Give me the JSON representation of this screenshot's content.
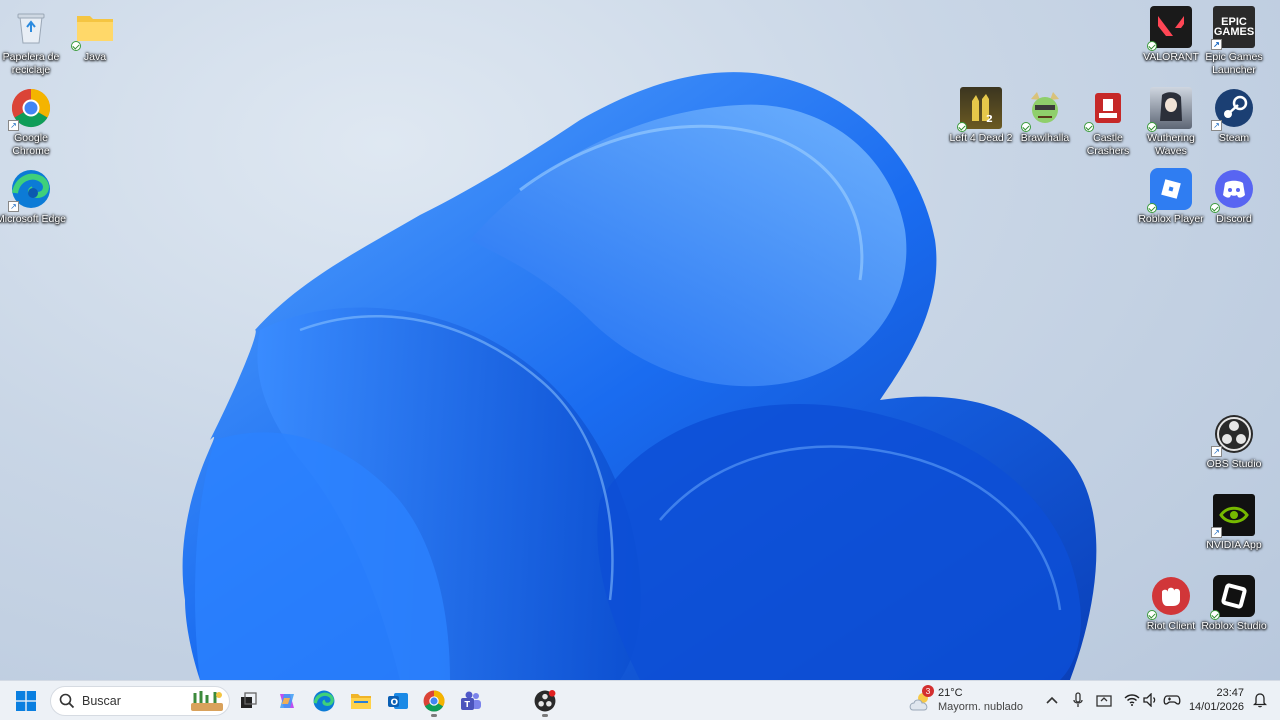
{
  "desktop": {
    "icons": [
      {
        "label": "Papelera de reciclaje",
        "icon": "recycle-bin-icon"
      },
      {
        "label": "Java",
        "icon": "folder-icon"
      },
      {
        "label": "Google Chrome",
        "icon": "chrome-icon"
      },
      {
        "label": "Microsoft Edge",
        "icon": "edge-icon"
      },
      {
        "label": "VALORANT",
        "icon": "valorant-icon"
      },
      {
        "label": "Epic Games Launcher",
        "icon": "epic-games-icon",
        "glyph_text": "EPIC\nGAMES"
      },
      {
        "label": "Left 4 Dead 2",
        "icon": "left4dead2-icon"
      },
      {
        "label": "Brawlhalla",
        "icon": "brawlhalla-icon"
      },
      {
        "label": "Castle Crashers",
        "icon": "castle-crashers-icon"
      },
      {
        "label": "Wuthering Waves",
        "icon": "wuthering-waves-icon"
      },
      {
        "label": "Steam",
        "icon": "steam-icon"
      },
      {
        "label": "Roblox Player",
        "icon": "roblox-player-icon"
      },
      {
        "label": "Discord",
        "icon": "discord-icon"
      },
      {
        "label": "OBS Studio",
        "icon": "obs-icon"
      },
      {
        "label": "NVIDIA App",
        "icon": "nvidia-icon"
      },
      {
        "label": "Riot Client",
        "icon": "riot-client-icon"
      },
      {
        "label": "Roblox Studio",
        "icon": "roblox-studio-icon"
      }
    ]
  },
  "taskbar": {
    "search_placeholder": "Buscar",
    "apps": [
      "start-icon",
      "task-view-icon",
      "copilot-icon",
      "edge-icon",
      "file-explorer-icon",
      "outlook-icon",
      "chrome-icon",
      "teams-icon",
      "obs-icon"
    ],
    "weather": {
      "badge": "3",
      "temp": "21°C",
      "desc": "Mayorm. nublado"
    },
    "clock": {
      "time": "23:47",
      "date": "14/01/2026"
    }
  },
  "colors": {
    "accent": "#0067c0",
    "wallpaper_blue": "#1565e0",
    "taskbar_bg": "#eef2f7"
  }
}
